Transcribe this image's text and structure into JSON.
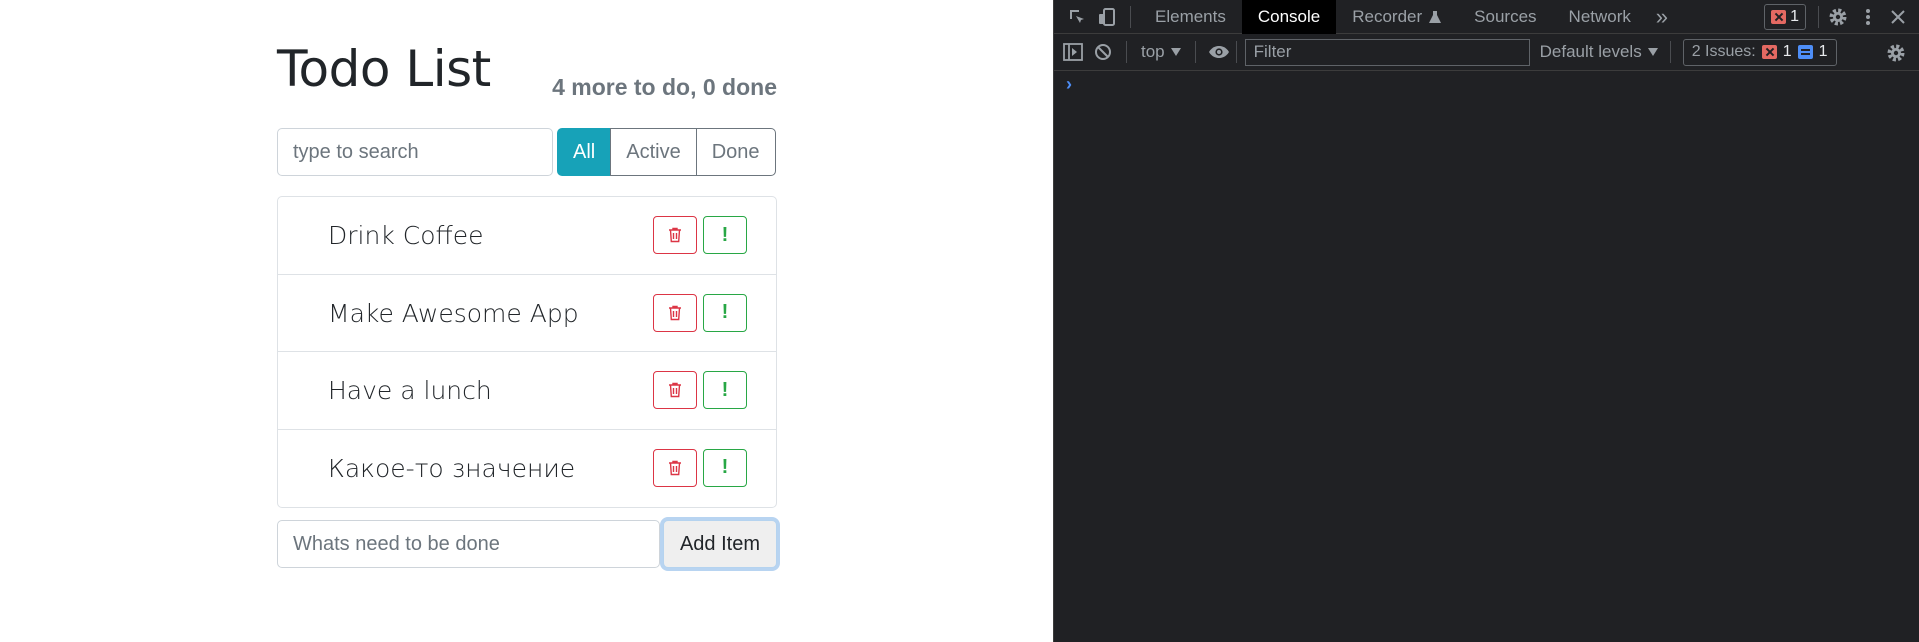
{
  "app": {
    "title": "Todo List",
    "stats": "4 more to do, 0 done",
    "search_placeholder": "type to search",
    "filters": [
      {
        "label": "All",
        "active": true
      },
      {
        "label": "Active",
        "active": false
      },
      {
        "label": "Done",
        "active": false
      }
    ],
    "items": [
      {
        "label": "Drink Coffee",
        "delete_icon": "trash-icon",
        "important_icon": "exclamation-icon",
        "important_glyph": "!"
      },
      {
        "label": "Make Awesome App",
        "delete_icon": "trash-icon",
        "important_icon": "exclamation-icon",
        "important_glyph": "!"
      },
      {
        "label": "Have a lunch",
        "delete_icon": "trash-icon",
        "important_icon": "exclamation-icon",
        "important_glyph": "!"
      },
      {
        "label": "Какое-то значение",
        "delete_icon": "trash-icon",
        "important_icon": "exclamation-icon",
        "important_glyph": "!"
      }
    ],
    "add_placeholder": "Whats need to be done",
    "add_label": "Add Item",
    "colors": {
      "accent": "#17a2b8",
      "danger": "#dc3545",
      "success": "#28a745"
    }
  },
  "devtools": {
    "tabs": [
      {
        "label": "Elements",
        "active": false
      },
      {
        "label": "Console",
        "active": true
      },
      {
        "label": "Recorder",
        "active": false
      },
      {
        "label": "Sources",
        "active": false
      },
      {
        "label": "Network",
        "active": false
      }
    ],
    "more_tabs_glyph": "»",
    "error_count": "1",
    "context": "top",
    "filter_placeholder": "Filter",
    "levels_label": "Default levels",
    "issues_label": "2 Issues:",
    "issues_error_count": "1",
    "issues_info_count": "1",
    "prompt_glyph": "›"
  }
}
